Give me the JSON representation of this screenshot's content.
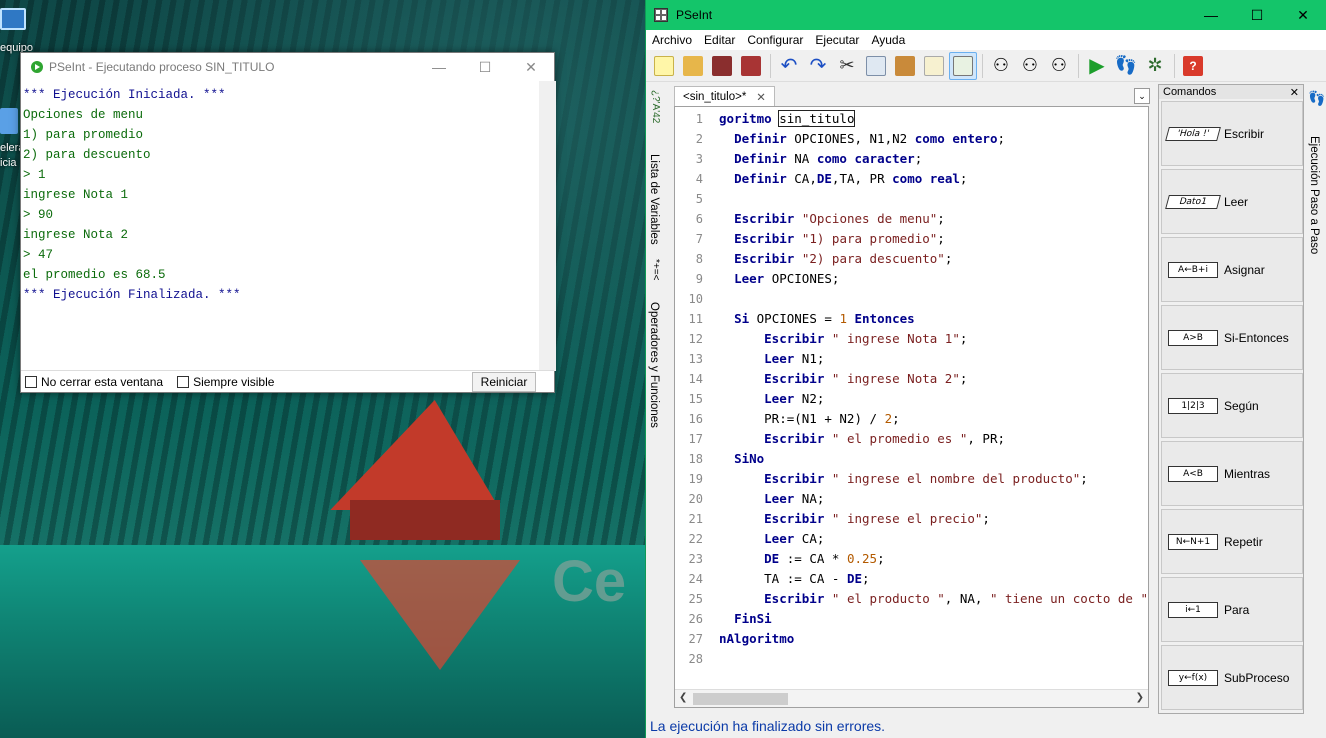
{
  "desktop": {
    "icons": [
      {
        "label": "equipo"
      },
      {
        "label": "elera"
      },
      {
        "label": "icia"
      }
    ],
    "wallpaper_text": "Ce"
  },
  "run_window": {
    "title": "PSeInt - Ejecutando proceso SIN_TITULO",
    "console_lines": [
      {
        "text": "*** Ejecución Iniciada. ***",
        "color": "blue"
      },
      {
        "text": "Opciones de menu",
        "color": "green"
      },
      {
        "text": "1) para promedio",
        "color": "green"
      },
      {
        "text": "2) para descuento",
        "color": "green"
      },
      {
        "text": "> 1",
        "color": "green"
      },
      {
        "text": " ingrese Nota 1",
        "color": "green"
      },
      {
        "text": "> 90",
        "color": "green"
      },
      {
        "text": " ingrese Nota 2",
        "color": "green"
      },
      {
        "text": "> 47",
        "color": "green"
      },
      {
        "text": " el promedio es 68.5",
        "color": "green"
      },
      {
        "text": "*** Ejecución Finalizada. ***",
        "color": "blue"
      }
    ],
    "no_cerrar_label": "No cerrar esta ventana",
    "siempre_visible_label": "Siempre visible",
    "reiniciar_label": "Reiniciar"
  },
  "main": {
    "title": "PSeInt",
    "menu": [
      "Archivo",
      "Editar",
      "Configurar",
      "Ejecutar",
      "Ayuda"
    ],
    "file_tab": "<sin_titulo>*",
    "vertical_tabs": [
      "Lista de Variables",
      "Operadores y Funciones"
    ],
    "right_tab": "Ejecución Paso a Paso",
    "commands_title": "Comandos",
    "commands": [
      {
        "label": "Escribir",
        "glyph": "'Hola !'"
      },
      {
        "label": "Leer",
        "glyph": "Dato1"
      },
      {
        "label": "Asignar",
        "glyph": "A←B+i"
      },
      {
        "label": "Si-Entonces",
        "glyph": "A>B"
      },
      {
        "label": "Según",
        "glyph": "1|2|3"
      },
      {
        "label": "Mientras",
        "glyph": "A<B"
      },
      {
        "label": "Repetir",
        "glyph": "N←N+1"
      },
      {
        "label": "Para",
        "glyph": "i←1"
      },
      {
        "label": "SubProceso",
        "glyph": "y←f(x)"
      }
    ],
    "status": "La ejecución ha finalizado sin errores."
  },
  "code_lines": [
    {
      "n": "1",
      "html": "<span class='kw'>goritmo</span> <span class='hl-box'>sin_titulo</span>"
    },
    {
      "n": "2",
      "html": "  <span class='kw'>Definir</span> OPCIONES, N1,N2 <span class='kw'>como entero</span>;"
    },
    {
      "n": "3",
      "html": "  <span class='kw'>Definir</span> NA <span class='kw'>como caracter</span>;"
    },
    {
      "n": "4",
      "html": "  <span class='kw'>Definir</span> CA,<span class='kw'>DE</span>,TA, PR <span class='kw'>como real</span>;"
    },
    {
      "n": "5",
      "html": ""
    },
    {
      "n": "6",
      "html": "  <span class='kw'>Escribir</span> <span class='str'>\"Opciones de menu\"</span>;"
    },
    {
      "n": "7",
      "html": "  <span class='kw'>Escribir</span> <span class='str'>\"1) para promedio\"</span>;"
    },
    {
      "n": "8",
      "html": "  <span class='kw'>Escribir</span> <span class='str'>\"2) para descuento\"</span>;"
    },
    {
      "n": "9",
      "html": "  <span class='kw'>Leer</span> OPCIONES;"
    },
    {
      "n": "10",
      "html": ""
    },
    {
      "n": "11",
      "html": "  <span class='kw'>Si</span> OPCIONES = <span class='num'>1</span> <span class='kw'>Entonces</span>"
    },
    {
      "n": "12",
      "html": "      <span class='kw'>Escribir</span> <span class='str'>\" ingrese Nota 1\"</span>;"
    },
    {
      "n": "13",
      "html": "      <span class='kw'>Leer</span> N1;"
    },
    {
      "n": "14",
      "html": "      <span class='kw'>Escribir</span> <span class='str'>\" ingrese Nota 2\"</span>;"
    },
    {
      "n": "15",
      "html": "      <span class='kw'>Leer</span> N2;"
    },
    {
      "n": "16",
      "html": "      PR:=(N1 + N2) / <span class='num'>2</span>;"
    },
    {
      "n": "17",
      "html": "      <span class='kw'>Escribir</span> <span class='str'>\" el promedio es \"</span>, PR;"
    },
    {
      "n": "18",
      "html": "  <span class='kw'>SiNo</span>"
    },
    {
      "n": "19",
      "html": "      <span class='kw'>Escribir</span> <span class='str'>\" ingrese el nombre del producto\"</span>;"
    },
    {
      "n": "20",
      "html": "      <span class='kw'>Leer</span> NA;"
    },
    {
      "n": "21",
      "html": "      <span class='kw'>Escribir</span> <span class='str'>\" ingrese el precio\"</span>;"
    },
    {
      "n": "22",
      "html": "      <span class='kw'>Leer</span> CA;"
    },
    {
      "n": "23",
      "html": "      <span class='kw'>DE</span> := CA * <span class='num'>0.25</span>;"
    },
    {
      "n": "24",
      "html": "      TA := CA - <span class='kw'>DE</span>;"
    },
    {
      "n": "25",
      "html": "      <span class='kw'>Escribir</span> <span class='str'>\" el producto \"</span>, NA, <span class='str'>\" tiene un cocto de \"</span>, C"
    },
    {
      "n": "26",
      "html": "  <span class='kw'>FinSi</span>"
    },
    {
      "n": "27",
      "html": "<span class='kw'>nAlgoritmo</span>"
    },
    {
      "n": "28",
      "html": ""
    }
  ]
}
